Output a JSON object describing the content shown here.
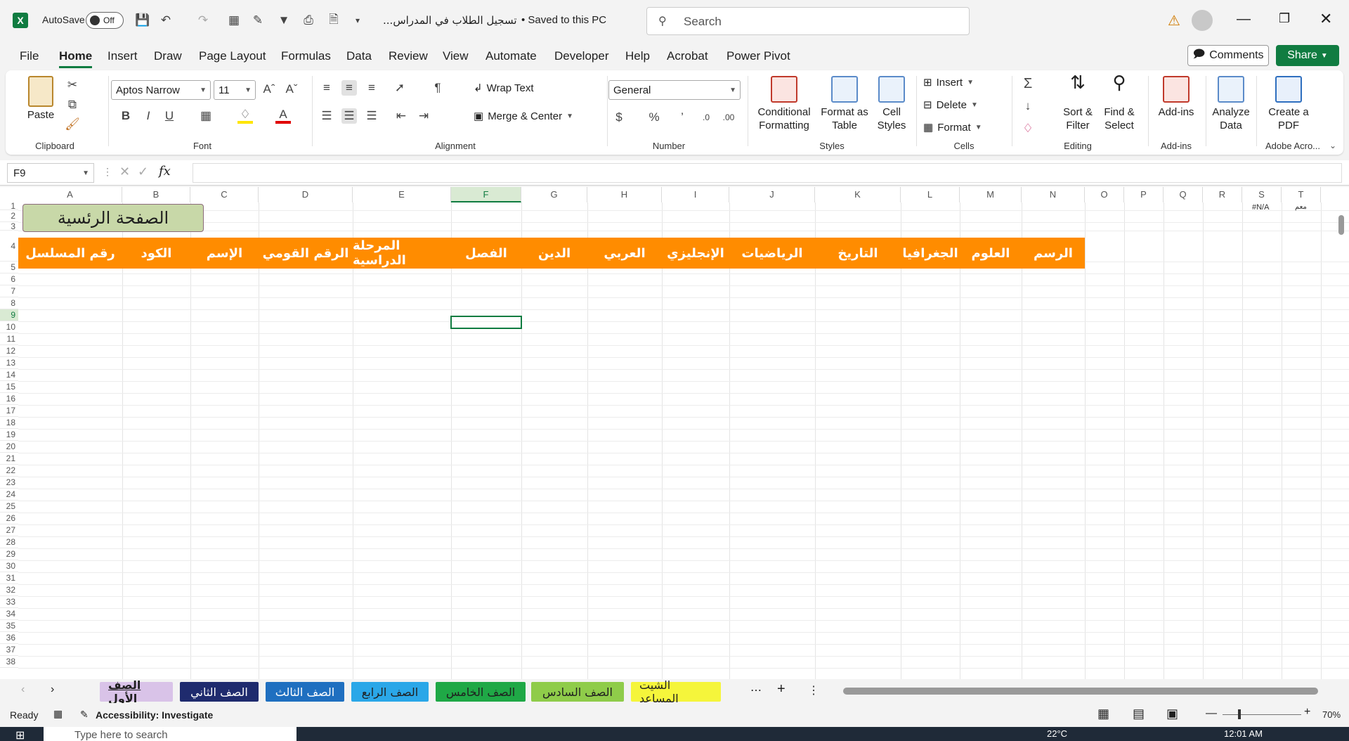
{
  "app": {
    "autosave_label": "AutoSave",
    "autosave_state": "Off",
    "doc_title": "...تسجيل الطلاب في المدراس",
    "save_status": "• Saved to this PC",
    "search_placeholder": "Search"
  },
  "menu": [
    "File",
    "Home",
    "Insert",
    "Draw",
    "Page Layout",
    "Formulas",
    "Data",
    "Review",
    "View",
    "Automate",
    "Developer",
    "Help",
    "Acrobat",
    "Power Pivot"
  ],
  "comments_label": "Comments",
  "share_label": "Share",
  "ribbon": {
    "clipboard": {
      "paste": "Paste",
      "label": "Clipboard"
    },
    "font": {
      "name": "Aptos Narrow",
      "size": "11",
      "bold": "B",
      "italic": "I",
      "underline": "U",
      "label": "Font"
    },
    "alignment": {
      "wrap": "Wrap Text",
      "merge": "Merge & Center",
      "label": "Alignment"
    },
    "number": {
      "format": "General",
      "label": "Number"
    },
    "styles": {
      "conditional": "Conditional Formatting",
      "format_table": "Format as Table",
      "cell_styles": "Cell Styles",
      "label": "Styles"
    },
    "cells": {
      "insert": "Insert",
      "delete": "Delete",
      "format": "Format",
      "label": "Cells"
    },
    "editing": {
      "sort": "Sort & Filter",
      "find": "Find & Select",
      "label": "Editing"
    },
    "addins": {
      "addins": "Add-ins",
      "label": "Add-ins"
    },
    "analyze": {
      "label": "Analyze Data"
    },
    "acrobat": {
      "create": "Create a PDF",
      "label": "Adobe Acro..."
    }
  },
  "namebox": "F9",
  "formula_value": "",
  "columns": [
    "A",
    "B",
    "C",
    "D",
    "E",
    "F",
    "G",
    "H",
    "I",
    "J",
    "K",
    "L",
    "M",
    "N",
    "O",
    "P",
    "Q",
    "R",
    "S",
    "T"
  ],
  "rows": [
    "1",
    "2",
    "3",
    "4",
    "5",
    "6",
    "7",
    "8",
    "9",
    "10",
    "11",
    "12",
    "13",
    "14",
    "15",
    "16",
    "17",
    "18",
    "19",
    "20",
    "21",
    "22",
    "23",
    "24",
    "25",
    "26",
    "27",
    "28",
    "29",
    "30",
    "31",
    "32",
    "33",
    "34",
    "35",
    "36",
    "37",
    "38"
  ],
  "home_button": "الصفحة الرئسية",
  "headers": [
    "رقم المسلسل",
    "الكود",
    "الإسم",
    "الرقم القومي",
    "المرحلة الدراسية",
    "الفصل",
    "الدين",
    "العربي",
    "الإنجليزي",
    "الرياضيات",
    "التاريخ",
    "الجغرافيا",
    "العلوم",
    "الرسم"
  ],
  "cell_s1": "#N/A",
  "cell_t1": "معم",
  "sheets": [
    {
      "name": "الصف الأول",
      "bg": "#d9c3e8",
      "color": "#1f1f1f"
    },
    {
      "name": "الصف الثاني",
      "bg": "#1f2b6e",
      "color": "#ffffff"
    },
    {
      "name": "الصف الثالث",
      "bg": "#1f6fc0",
      "color": "#ffffff"
    },
    {
      "name": "الصف الرابع",
      "bg": "#2aa7e8",
      "color": "#1f1f1f"
    },
    {
      "name": "الصف الخامس",
      "bg": "#1fa846",
      "color": "#1f1f1f"
    },
    {
      "name": "الصف السادس",
      "bg": "#8fcc4a",
      "color": "#1f1f1f"
    },
    {
      "name": "الشيت المساعد",
      "bg": "#f5f53b",
      "color": "#1f1f1f"
    }
  ],
  "status": {
    "ready": "Ready",
    "accessibility": "Accessibility: Investigate",
    "zoom": "70%"
  },
  "taskbar": {
    "search": "Type here to search",
    "time": "12:01 AM",
    "temp": "22°C"
  },
  "colors": {
    "header_orange": "#ff8c00",
    "excel_green": "#107c41",
    "home_btn_bg": "#c8d8a8"
  }
}
